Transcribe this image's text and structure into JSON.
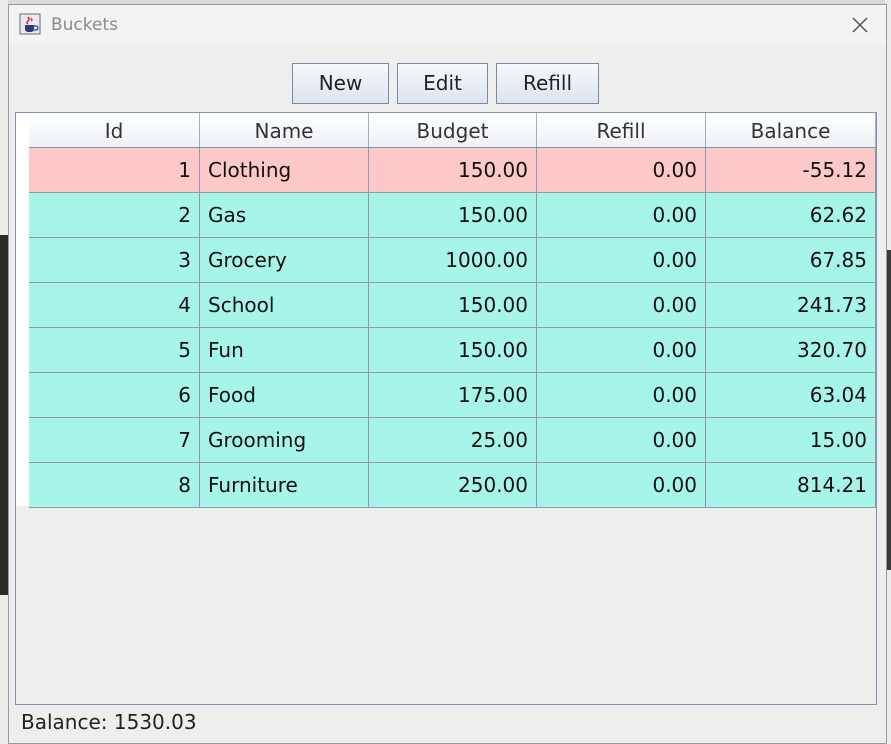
{
  "window": {
    "title": "Buckets"
  },
  "toolbar": {
    "new_label": "New",
    "edit_label": "Edit",
    "refill_label": "Refill"
  },
  "table": {
    "columns": [
      "Id",
      "Name",
      "Budget",
      "Refill",
      "Balance"
    ],
    "rows": [
      {
        "id": "1",
        "name": "Clothing",
        "budget": "150.00",
        "refill": "0.00",
        "balance": "-55.12",
        "status": "negative"
      },
      {
        "id": "2",
        "name": "Gas",
        "budget": "150.00",
        "refill": "0.00",
        "balance": "62.62",
        "status": "positive"
      },
      {
        "id": "3",
        "name": "Grocery",
        "budget": "1000.00",
        "refill": "0.00",
        "balance": "67.85",
        "status": "positive"
      },
      {
        "id": "4",
        "name": "School",
        "budget": "150.00",
        "refill": "0.00",
        "balance": "241.73",
        "status": "positive"
      },
      {
        "id": "5",
        "name": "Fun",
        "budget": "150.00",
        "refill": "0.00",
        "balance": "320.70",
        "status": "positive"
      },
      {
        "id": "6",
        "name": "Food",
        "budget": "175.00",
        "refill": "0.00",
        "balance": "63.04",
        "status": "positive"
      },
      {
        "id": "7",
        "name": "Grooming",
        "budget": "25.00",
        "refill": "0.00",
        "balance": "15.00",
        "status": "positive"
      },
      {
        "id": "8",
        "name": "Furniture",
        "budget": "250.00",
        "refill": "0.00",
        "balance": "814.21",
        "status": "positive"
      }
    ]
  },
  "status": {
    "label": "Balance:",
    "value": "1530.03"
  },
  "colors": {
    "negative_row": "#fdc8c8",
    "positive_row": "#a6f5e8",
    "button_border": "#7a8aa0"
  },
  "icons": {
    "app": "java-cup-icon",
    "close": "close-icon"
  }
}
